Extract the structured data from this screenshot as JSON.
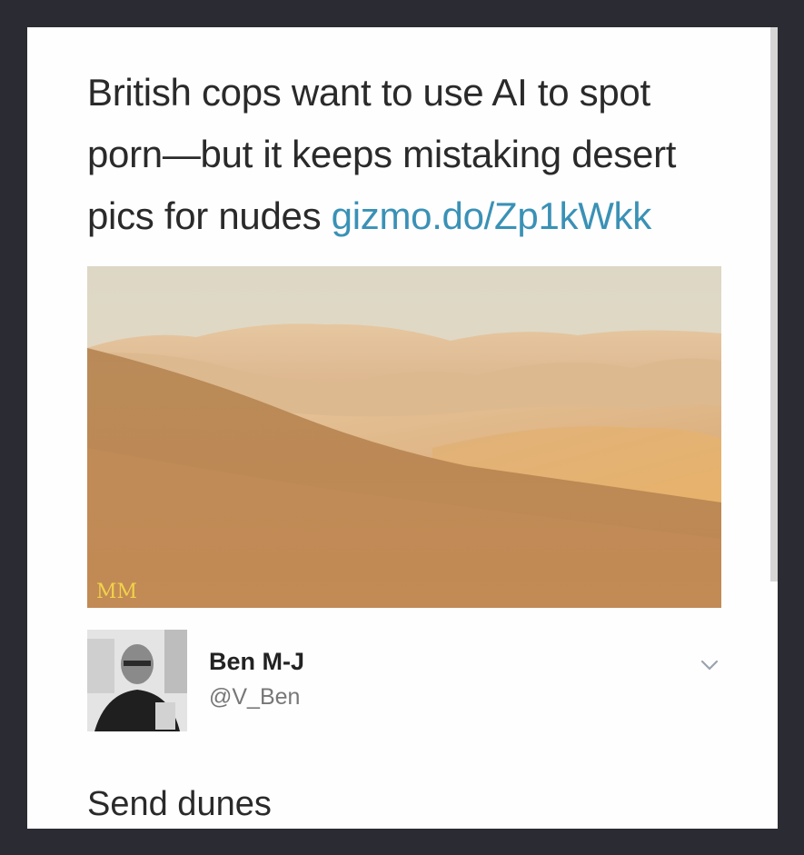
{
  "tweet": {
    "text_line1": "British cops want to use AI to spot",
    "text_line2": "porn—but it keeps mistaking desert",
    "text_line3": "pics for nudes ",
    "link": "gizmo.do/Zp1kWkk"
  },
  "media": {
    "watermark": "MM",
    "icon": "desert-photo"
  },
  "author": {
    "name": "Ben M-J",
    "handle": "@V_Ben",
    "menu_icon": "chevron-down-icon"
  },
  "reply": {
    "text": "Send dunes"
  },
  "colors": {
    "background": "#2b2c33",
    "card": "#fefefe",
    "link": "#3a91b6",
    "text": "#2a2a2a",
    "muted": "#777777"
  }
}
